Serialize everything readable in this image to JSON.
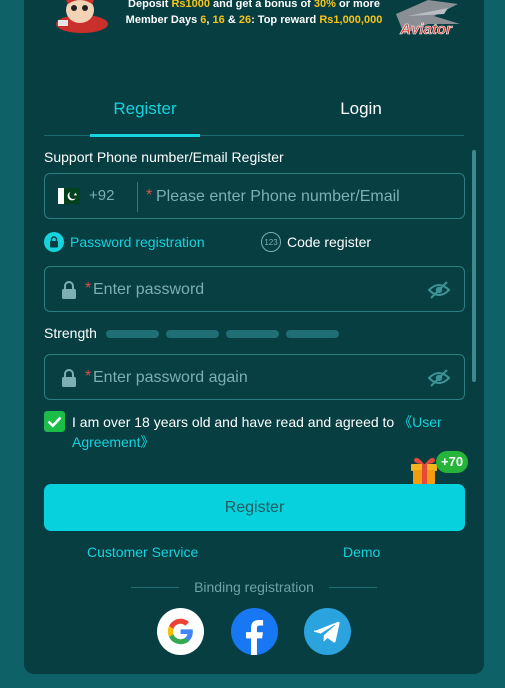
{
  "banner": {
    "line1_a": "Deposit ",
    "line1_amount": "Rs1000",
    "line1_b": " and get a bonus of ",
    "line1_percent": "30%",
    "line1_c": " or more",
    "line2_a": "Member Days ",
    "day1": "6",
    "sep1": ", ",
    "day2": "16",
    "sep2": " & ",
    "day3": "26",
    "line2_b": ": Top reward ",
    "reward": "Rs1,000,000",
    "game_logo": "Aviator"
  },
  "tabs": [
    {
      "label": "Register",
      "active": true
    },
    {
      "label": "Login",
      "active": false
    }
  ],
  "form": {
    "section_title": "Support Phone number/Email Register",
    "country_code": "+92",
    "required_mark": "*",
    "phone_placeholder": "Please enter Phone number/Email",
    "mode_password": "Password registration",
    "mode_code": "Code register",
    "mode_code_icon_text": "123",
    "password_placeholder": "Enter password",
    "strength_label": "Strength",
    "strength_segments": 4,
    "strength_filled": 0,
    "password_again_placeholder": "Enter password again",
    "agree_checked": true,
    "agree_text": "I am over 18 years old and have read and agreed to ",
    "agree_link": "《User Agreement》",
    "bonus_badge": "+70",
    "register_button": "Register"
  },
  "links": {
    "customer_service": "Customer Service",
    "demo": "Demo"
  },
  "binding": {
    "label": "Binding registration",
    "providers": [
      "google-icon",
      "facebook-icon",
      "telegram-icon"
    ]
  },
  "colors": {
    "background": "#0e6166",
    "panel": "#063e42",
    "accent": "#16d3dc",
    "button": "#06d1dc",
    "checkbox": "#1cbc48",
    "highlight": "#f5c419",
    "required": "#e0514c"
  }
}
